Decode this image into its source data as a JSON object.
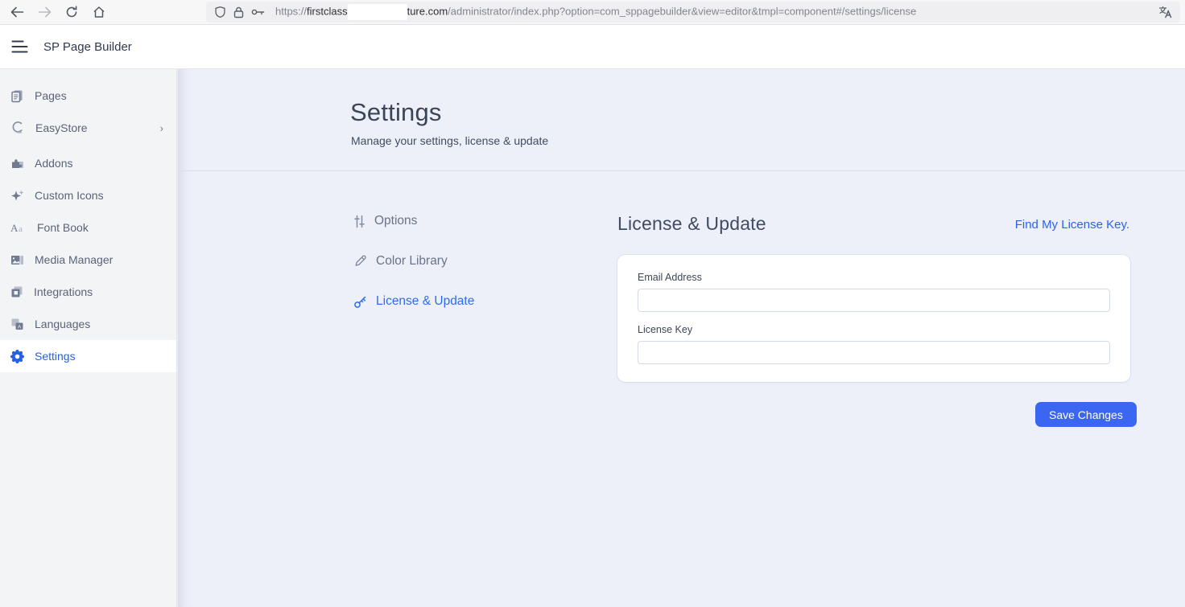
{
  "browser": {
    "url": {
      "scheme": "https://",
      "host_prefix": "firstclass",
      "host_suffix": "ture.com",
      "path": "/administrator/index.php?option=com_sppagebuilder&view=editor&tmpl=component#/settings/license"
    },
    "icons": [
      "back-icon",
      "forward-icon",
      "refresh-icon",
      "home-icon",
      "shield-icon",
      "lock-icon",
      "key-icon",
      "translate-icon"
    ]
  },
  "app_header": {
    "title": "SP Page Builder"
  },
  "sidebar": {
    "items": [
      {
        "label": "Pages"
      },
      {
        "label": "EasyStore",
        "chevron": "›"
      },
      {
        "label": "Addons"
      },
      {
        "label": "Custom Icons"
      },
      {
        "label": "Font Book"
      },
      {
        "label": "Media Manager"
      },
      {
        "label": "Integrations"
      },
      {
        "label": "Languages"
      },
      {
        "label": "Settings",
        "active": true
      }
    ]
  },
  "page": {
    "title": "Settings",
    "subtitle": "Manage your settings, license & update"
  },
  "settings_nav": {
    "items": [
      {
        "label": "Options"
      },
      {
        "label": "Color Library"
      },
      {
        "label": "License & Update",
        "active": true
      }
    ]
  },
  "license_section": {
    "heading": "License & Update",
    "find_link": "Find My License Key.",
    "email_label": "Email Address",
    "email_value": "",
    "license_label": "License Key",
    "license_value": "",
    "save_button": "Save Changes"
  },
  "colors": {
    "accent_blue": "#2461e8",
    "button_blue": "#3b66f2",
    "main_bg": "#edf0f9",
    "sidebar_bg": "#f3f4f6",
    "heading_text": "#3c4557"
  }
}
